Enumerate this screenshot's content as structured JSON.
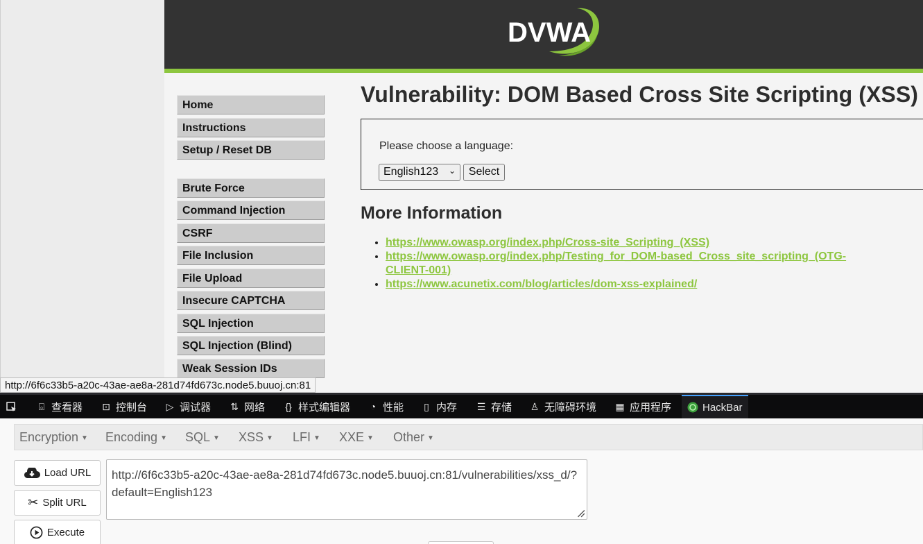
{
  "page": {
    "logo_text": "DVWA",
    "menu_primary": [
      "Home",
      "Instructions",
      "Setup / Reset DB"
    ],
    "menu_vulns": [
      "Brute Force",
      "Command Injection",
      "CSRF",
      "File Inclusion",
      "File Upload",
      "Insecure CAPTCHA",
      "SQL Injection",
      "SQL Injection (Blind)",
      "Weak Session IDs"
    ],
    "title": "Vulnerability: DOM Based Cross Site Scripting (XSS)",
    "lang_label": "Please choose a language:",
    "lang_selected": "English123",
    "select_button": "Select",
    "more_info_heading": "More Information",
    "links": [
      "https://www.owasp.org/index.php/Cross-site_Scripting_(XSS)",
      "https://www.owasp.org/index.php/Testing_for_DOM-based_Cross_site_scripting_(OTG-CLIENT-001)",
      "https://www.acunetix.com/blog/articles/dom-xss-explained/"
    ],
    "status_url": "http://6f6c33b5-a20c-43ae-ae8a-281d74fd673c.node5.buuoj.cn:81"
  },
  "devtools": {
    "tabs": [
      "查看器",
      "控制台",
      "调试器",
      "网络",
      "样式编辑器",
      "性能",
      "内存",
      "存储",
      "无障碍环境",
      "应用程序",
      "HackBar"
    ],
    "active_tab": "HackBar"
  },
  "hackbar": {
    "menu": [
      "Encryption",
      "Encoding",
      "SQL",
      "XSS",
      "LFI",
      "XXE",
      "Other"
    ],
    "buttons": {
      "load": "Load URL",
      "split": "Split URL",
      "execute": "Execute"
    },
    "url": "http://6f6c33b5-a20c-43ae-ae8a-281d74fd673c.node5.buuoj.cn:81/vulnerabilities/xss_d/?default=English123"
  },
  "colors": {
    "dvwa_green": "#8dc63f",
    "header_bg": "#333333",
    "devtools_bg": "#0c0c0d"
  }
}
